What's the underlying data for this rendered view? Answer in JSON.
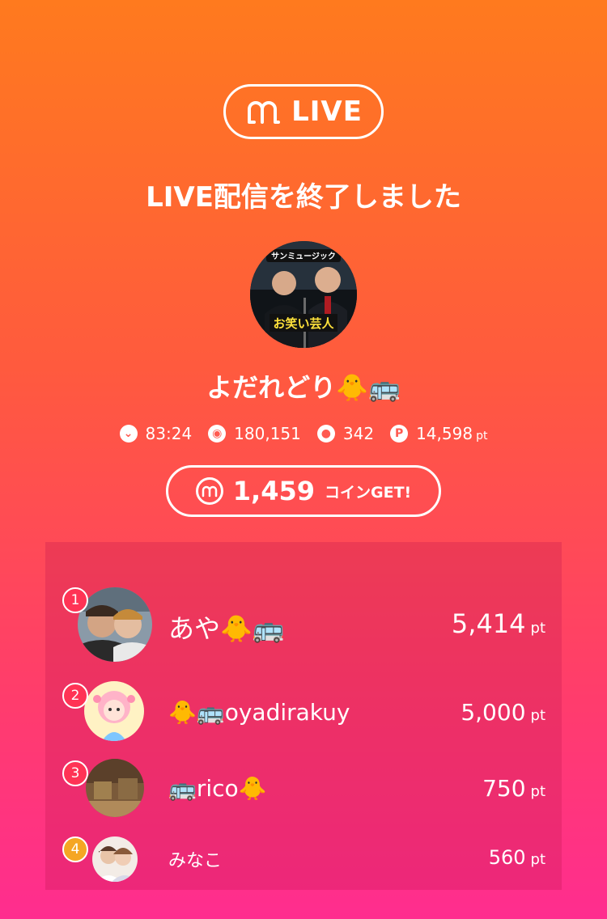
{
  "brand": {
    "logo_text": "LIVE"
  },
  "headline": "LIVE配信を終了しました",
  "host": {
    "avatar_caption_top": "サンミュージック",
    "avatar_caption_bottom": "お笑い芸人",
    "name": "よだれどり🐥🚌"
  },
  "stats": {
    "duration": "83:24",
    "views": "180,151",
    "comments": "342",
    "points": "14,598",
    "points_unit": "pt"
  },
  "coins": {
    "amount": "1,459",
    "suffix": "コインGET!"
  },
  "ranking": [
    {
      "rank": "1",
      "name": "あや🐥🚌",
      "score": "5,414",
      "unit": "pt"
    },
    {
      "rank": "2",
      "name": "🐥🚌oyadirakuy",
      "score": "5,000",
      "unit": "pt"
    },
    {
      "rank": "3",
      "name": "🚌rico🐥",
      "score": "750",
      "unit": "pt"
    },
    {
      "rank": "4",
      "name": "みなこ",
      "score": "560",
      "unit": "pt"
    }
  ],
  "colors": {
    "gradient_top": "#FF7A1E",
    "gradient_bottom": "#FF2D8F",
    "rank_badge": "#FF3355",
    "rank_badge_4": "#F5A623"
  }
}
